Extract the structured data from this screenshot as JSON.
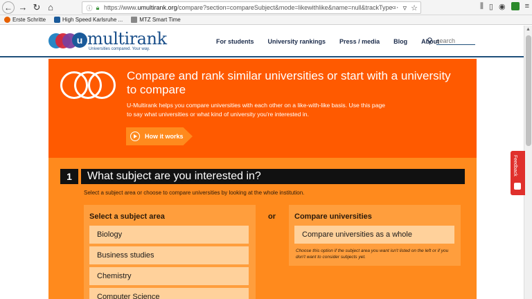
{
  "browser": {
    "url_prefix": "https://www.",
    "url_domain": "umultirank.org",
    "url_rest": "/compare?section=compareSubject&mode=likewithlike&name=null&trackType=",
    "bookmarks": [
      {
        "label": "Erste Schritte",
        "color": "#e66000"
      },
      {
        "label": "High Speed Karlsruhe ...",
        "color": "#1a5a9a"
      },
      {
        "label": "MTZ Smart Time",
        "color": "#666666"
      }
    ]
  },
  "site": {
    "logo_word": "multirank",
    "logo_u": "u",
    "logo_tagline": "Universities compared. Your way.",
    "nav": [
      "For students",
      "University rankings",
      "Press / media",
      "Blog",
      "About"
    ],
    "search_placeholder": "search"
  },
  "hero": {
    "title": "Compare and rank similar universities or start with a university to compare",
    "description": "U-Multirank helps you compare universities with each other on a like-with-like basis. Use this page to say what universities or what kind of university you're interested in.",
    "how_button": "How it works"
  },
  "step": {
    "number": "1",
    "title": "What subject are you interested in?",
    "subtitle": "Select a subject area or choose to compare universities by looking at the whole institution."
  },
  "subject_panel": {
    "title": "Select a subject area",
    "items": [
      "Biology",
      "Business studies",
      "Chemistry",
      "Computer Science"
    ]
  },
  "or_label": "or",
  "compare_panel": {
    "title": "Compare universities",
    "button": "Compare universities as a whole",
    "note": "Choose this option if the subject area you want isn't listed on the left or if you don't want to consider subjects yet."
  },
  "feedback": {
    "label": "Feedback"
  },
  "colors": {
    "hero_bg": "#ff5a00",
    "content_bg": "#ff8a1d",
    "panel_bg": "#ff9e3d",
    "item_bg": "#ffd19b",
    "brand_blue": "#1a4f8a",
    "feedback_red": "#e0302c"
  }
}
